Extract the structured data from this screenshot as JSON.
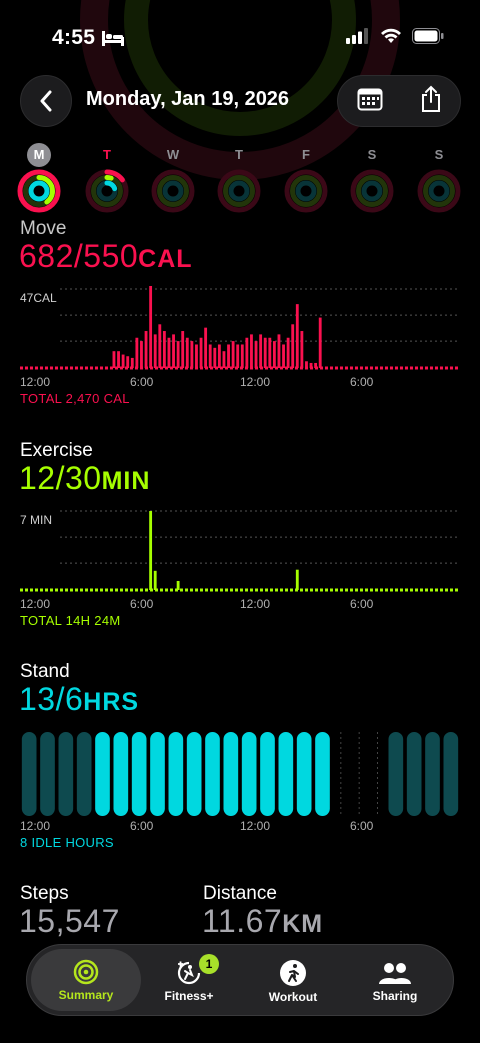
{
  "status_bar": {
    "time": "4:55"
  },
  "nav": {
    "title": "Monday, Jan 19, 2026"
  },
  "week": {
    "days": [
      {
        "letter": "M",
        "move": 1.0,
        "exercise": 0.4,
        "stand": 1.0
      },
      {
        "letter": "T",
        "move": 0.15,
        "exercise": 0.05,
        "stand": 0.2
      },
      {
        "letter": "W",
        "move": 0,
        "exercise": 0,
        "stand": 0
      },
      {
        "letter": "T",
        "move": 0,
        "exercise": 0,
        "stand": 0
      },
      {
        "letter": "F",
        "move": 0,
        "exercise": 0,
        "stand": 0
      },
      {
        "letter": "S",
        "move": 0,
        "exercise": 0,
        "stand": 0
      },
      {
        "letter": "S",
        "move": 0,
        "exercise": 0,
        "stand": 0
      }
    ]
  },
  "move": {
    "label": "Move",
    "value": "682/550",
    "unit": "CAL",
    "max_label": "47CAL",
    "total": "TOTAL 2,470 CAL",
    "color": "#fa114f"
  },
  "exercise": {
    "label": "Exercise",
    "value": "12/30",
    "unit": "MIN",
    "max_label": "7 MIN",
    "total": "TOTAL 14H 24M",
    "color": "#a6ff00"
  },
  "stand": {
    "label": "Stand",
    "value": "13/6",
    "unit": "HRS",
    "total": "8 IDLE HOURS",
    "color": "#00d8e0"
  },
  "axis_labels": [
    "12:00",
    "6:00",
    "12:00",
    "6:00"
  ],
  "steps": {
    "label": "Steps",
    "value": "15,547"
  },
  "distance": {
    "label": "Distance",
    "value": "11.67",
    "unit": "KM"
  },
  "tabs": [
    {
      "label": "Summary",
      "active": true
    },
    {
      "label": "Fitness+",
      "badge": "1"
    },
    {
      "label": "Workout"
    },
    {
      "label": "Sharing"
    }
  ],
  "chart_data": [
    {
      "type": "bar",
      "title": "Move",
      "ylabel": "CAL",
      "ylim": [
        0,
        47
      ],
      "x_ticks": [
        "12:00",
        "6:00",
        "12:00",
        "6:00"
      ],
      "values": [
        2,
        2,
        2,
        2,
        2,
        2,
        2,
        2,
        2,
        2,
        2,
        2,
        2,
        2,
        2,
        2,
        2,
        2,
        2,
        2,
        10,
        10,
        8,
        7,
        6,
        18,
        16,
        22,
        55,
        20,
        26,
        22,
        18,
        20,
        16,
        22,
        18,
        16,
        14,
        18,
        24,
        14,
        12,
        14,
        10,
        14,
        16,
        14,
        14,
        18,
        20,
        16,
        20,
        18,
        18,
        16,
        20,
        14,
        18,
        26,
        38,
        22,
        4,
        3,
        3,
        30,
        2,
        2,
        2,
        2,
        2,
        2,
        2,
        2,
        2,
        2,
        2,
        2,
        2,
        2,
        2,
        2,
        2,
        2,
        2,
        2,
        2,
        2,
        2,
        2,
        2,
        2,
        2,
        2,
        2,
        2
      ]
    },
    {
      "type": "bar",
      "title": "Exercise",
      "ylabel": "MIN",
      "ylim": [
        0,
        7
      ],
      "x_ticks": [
        "12:00",
        "6:00",
        "12:00",
        "6:00"
      ],
      "values": [
        0,
        0,
        0,
        0,
        0,
        0,
        0,
        0,
        0,
        0,
        0,
        0,
        0,
        0,
        0,
        0,
        0,
        0,
        0,
        0,
        0,
        0,
        0,
        0,
        0,
        0,
        0,
        0,
        7,
        1.7,
        0,
        0,
        0,
        0,
        0.8,
        0,
        0,
        0,
        0,
        0,
        0,
        0,
        0,
        0,
        0,
        0,
        0,
        0,
        0,
        0,
        0,
        0,
        0,
        0,
        0,
        0,
        0,
        0,
        0,
        0,
        1.8,
        0,
        0,
        0,
        0,
        0,
        0,
        0,
        0,
        0,
        0,
        0,
        0,
        0,
        0,
        0,
        0,
        0,
        0,
        0,
        0,
        0,
        0,
        0,
        0,
        0,
        0,
        0,
        0,
        0,
        0,
        0,
        0,
        0,
        0,
        0
      ]
    },
    {
      "type": "bar",
      "title": "Stand",
      "x_ticks": [
        "12:00",
        "6:00",
        "12:00",
        "6:00"
      ],
      "values": [
        0,
        0,
        0,
        0,
        1,
        1,
        1,
        1,
        1,
        1,
        1,
        1,
        1,
        1,
        1,
        1,
        1,
        -1,
        -1,
        -1,
        0,
        0,
        0,
        0
      ]
    }
  ]
}
